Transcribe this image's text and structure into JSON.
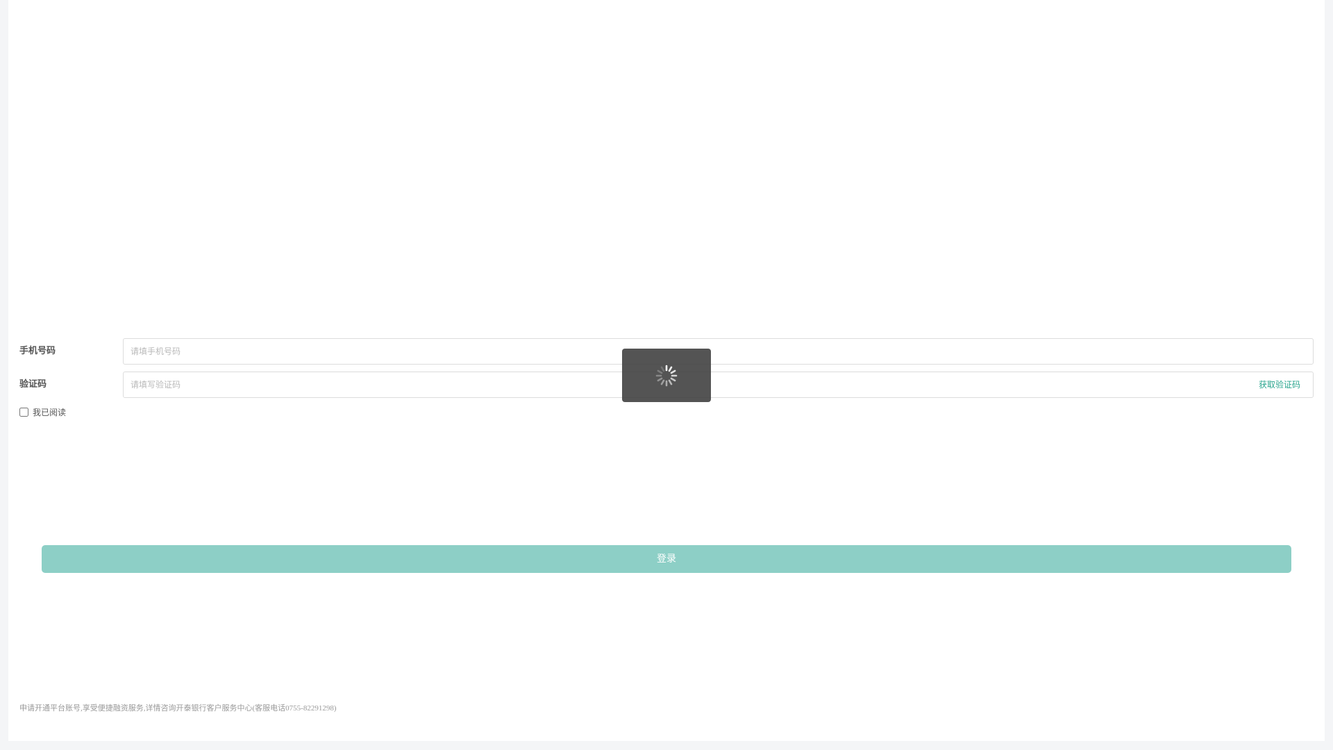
{
  "form": {
    "phone_label": "手机号码",
    "phone_placeholder": "请填手机号码",
    "code_label": "验证码",
    "code_placeholder": "请填写验证码",
    "get_code_label": "获取验证码",
    "agree_label": "我已阅读"
  },
  "actions": {
    "login_label": "登录"
  },
  "footer": {
    "note": "申请开通平台账号,享受便捷融资服务,详情咨询开泰银行客户服务中心(客服电话0755-82291298)"
  },
  "loading": {
    "icon": "spinner-icon"
  },
  "colors": {
    "accent": "#2aa58e",
    "button_disabled": "#8dcfc6",
    "toast_bg": "#3c3c3c"
  }
}
